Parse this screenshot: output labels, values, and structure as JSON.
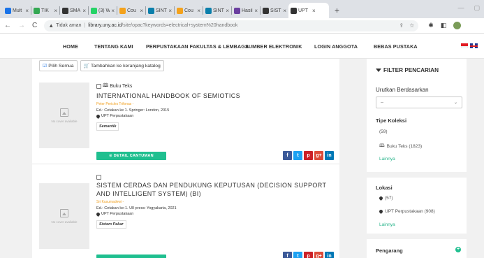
{
  "browser": {
    "tabs": [
      {
        "label": "Mult",
        "color": "#1a73e8"
      },
      {
        "label": "TIK",
        "color": "#34a853"
      },
      {
        "label": "SMA",
        "color": "#333333"
      },
      {
        "label": "(3) W",
        "color": "#25d366"
      },
      {
        "label": "Cou",
        "color": "#f4a21c"
      },
      {
        "label": "SINT",
        "color": "#0b7fab"
      },
      {
        "label": "Cou",
        "color": "#f4a21c"
      },
      {
        "label": "SINT",
        "color": "#0b7fab"
      },
      {
        "label": "Hasil",
        "color": "#6b3fa0"
      },
      {
        "label": "SISTE",
        "color": "#333333"
      },
      {
        "label": "UPT",
        "color": "#333333"
      }
    ],
    "tab_close": "×",
    "new_tab": "+",
    "address": {
      "security": "Tidak aman",
      "host": "library.uny.ac.id",
      "path": "/site/opac?keywords=electrical+system%20handbook"
    }
  },
  "site_nav": {
    "items": [
      "HOME",
      "TENTANG KAMI",
      "PERPUSTAKAAN FAKULTAS & LEMBAGA",
      "SUMBER ELEKTRONIK",
      "LOGIN ANGGOTA",
      "BEBAS PUSTAKA"
    ]
  },
  "actions": {
    "select_all": "Pilih Semua",
    "add_to_cart": "Tambahkan ke keranjang katalog"
  },
  "results": [
    {
      "type": "Buku Teks",
      "title": "INTERNATIONAL HANDBOOK OF SEMIOTICS",
      "author": "Peter Pericles Trifonas -",
      "edition": "Ed.: Cetakan ke 1. Springer: London, 2015",
      "location": "UPT Perpustakaan",
      "subject": "Semantik",
      "cover_text": "No cover available",
      "detail_label": "⊙ DETAIL CANTUMAN"
    },
    {
      "type": "",
      "title": "SISTEM CERDAS DAN PENDUKUNG KEPUTUSAN (DECISION SUPPORT AND INTELLIGENT SYSTEM) (BI)",
      "author": "Sri Kusumadewi -",
      "edition": "Ed.: Cetakan ke-1. UII press: Yogyakarta, 2021",
      "location": "UPT Perpustakaan",
      "subject": "Sistem Pakar",
      "cover_text": "No cover available",
      "detail_label": ""
    }
  ],
  "share_icons": [
    {
      "name": "facebook",
      "glyph": "f",
      "color": "#3b5998"
    },
    {
      "name": "twitter",
      "glyph": "t",
      "color": "#1da1f2"
    },
    {
      "name": "pinterest",
      "glyph": "p",
      "color": "#cb2027"
    },
    {
      "name": "google-plus",
      "glyph": "g+",
      "color": "#dd4b39"
    },
    {
      "name": "linkedin",
      "glyph": "in",
      "color": "#0077b5"
    }
  ],
  "sidebar": {
    "title": "FILTER PENCARIAN",
    "sort_label": "Urutkan Berdasarkan",
    "sort_value": "--",
    "collection_label": "Tipe Koleksi",
    "collection_count": "(59)",
    "collection_item": "Buku Teks (1823)",
    "collection_more": "Lainnya",
    "location_label": "Lokasi",
    "location_count": "(57)",
    "location_item": "UPT Perpustakaan (908)",
    "location_more": "Lainnya",
    "author_label": "Pengarang"
  },
  "colors": {
    "accent": "#1fbf8f",
    "link": "#2bb58c",
    "author": "#f0a020"
  }
}
